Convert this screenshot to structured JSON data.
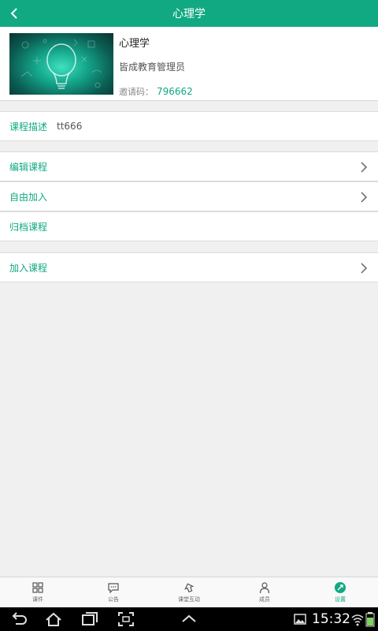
{
  "header": {
    "title": "心理学"
  },
  "course": {
    "name": "心理学",
    "owner": "皆成教育管理员",
    "invite_label": "邀请码：",
    "invite_code": "796662"
  },
  "description": {
    "label": "课程描述",
    "value": "tt666"
  },
  "actions": [
    {
      "label": "编辑课程",
      "has_arrow": true
    },
    {
      "label": "自由加入",
      "has_arrow": true
    },
    {
      "label": "归档课程",
      "has_arrow": false
    }
  ],
  "join": {
    "label": "加入课程",
    "has_arrow": true
  },
  "tabs": [
    {
      "label": "课件",
      "icon": "grid-icon",
      "active": false
    },
    {
      "label": "公告",
      "icon": "chat-icon",
      "active": false
    },
    {
      "label": "课堂互动",
      "icon": "interaction-icon",
      "active": false
    },
    {
      "label": "成员",
      "icon": "person-icon",
      "active": false
    },
    {
      "label": "设置",
      "icon": "settings-icon",
      "active": true
    }
  ],
  "system_bar": {
    "time": "15:32"
  },
  "colors": {
    "accent": "#11a982",
    "background": "#f0f0f0"
  }
}
